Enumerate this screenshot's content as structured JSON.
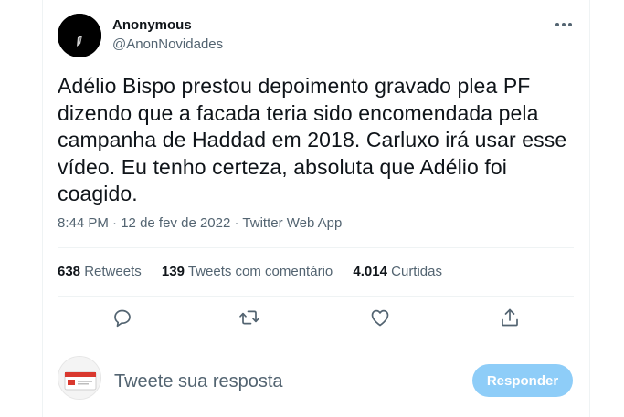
{
  "author": {
    "display_name": "Anonymous",
    "handle": "@AnonNovidades"
  },
  "tweet": {
    "text": "Adélio Bispo prestou depoimento gravado plea PF dizendo que a facada teria sido encomendada pela campanha de Haddad em 2018. Carluxo irá usar esse vídeo. Eu tenho certeza, absoluta que Adélio foi coagido.",
    "time": "8:44 PM",
    "separator": "·",
    "date": "12 de fev de 2022",
    "source": "Twitter Web App"
  },
  "stats": {
    "retweets_count": "638",
    "retweets_label": "Retweets",
    "quotes_count": "139",
    "quotes_label": "Tweets com comentário",
    "likes_count": "4.014",
    "likes_label": "Curtidas"
  },
  "actions": [
    "reply-icon",
    "retweet-icon",
    "like-icon",
    "share-icon"
  ],
  "reply_box": {
    "placeholder": "Tweete sua resposta",
    "button_label": "Responder"
  },
  "colors": {
    "text": "#0f1419",
    "secondary": "#536471",
    "button_disabled": "#8ecdf8",
    "divider": "#eff3f4"
  }
}
